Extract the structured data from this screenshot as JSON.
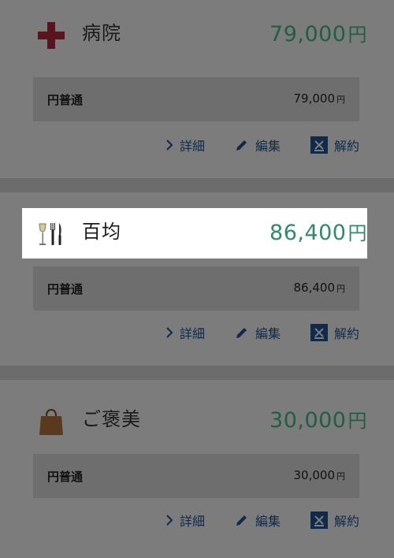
{
  "cards": [
    {
      "title": "病院",
      "amount": "79,000",
      "amount_unit": "円",
      "account": "円普通",
      "account_value": "79,000",
      "account_unit": "円",
      "icon": "hospital-cross-icon"
    },
    {
      "title": "百均",
      "amount": "86,400",
      "amount_unit": "円",
      "account": "円普通",
      "account_value": "86,400",
      "account_unit": "円",
      "icon": "dining-icon"
    },
    {
      "title": "ご褒美",
      "amount": "30,000",
      "amount_unit": "円",
      "account": "円普通",
      "account_value": "30,000",
      "account_unit": "円",
      "icon": "shopping-bag-icon"
    }
  ],
  "actions": {
    "details": "詳細",
    "edit": "編集",
    "cancel": "解約"
  },
  "colors": {
    "amount_green": "#2f8a6a",
    "action_navy": "#0f2a4a",
    "cross_red": "#8b1a2b"
  }
}
